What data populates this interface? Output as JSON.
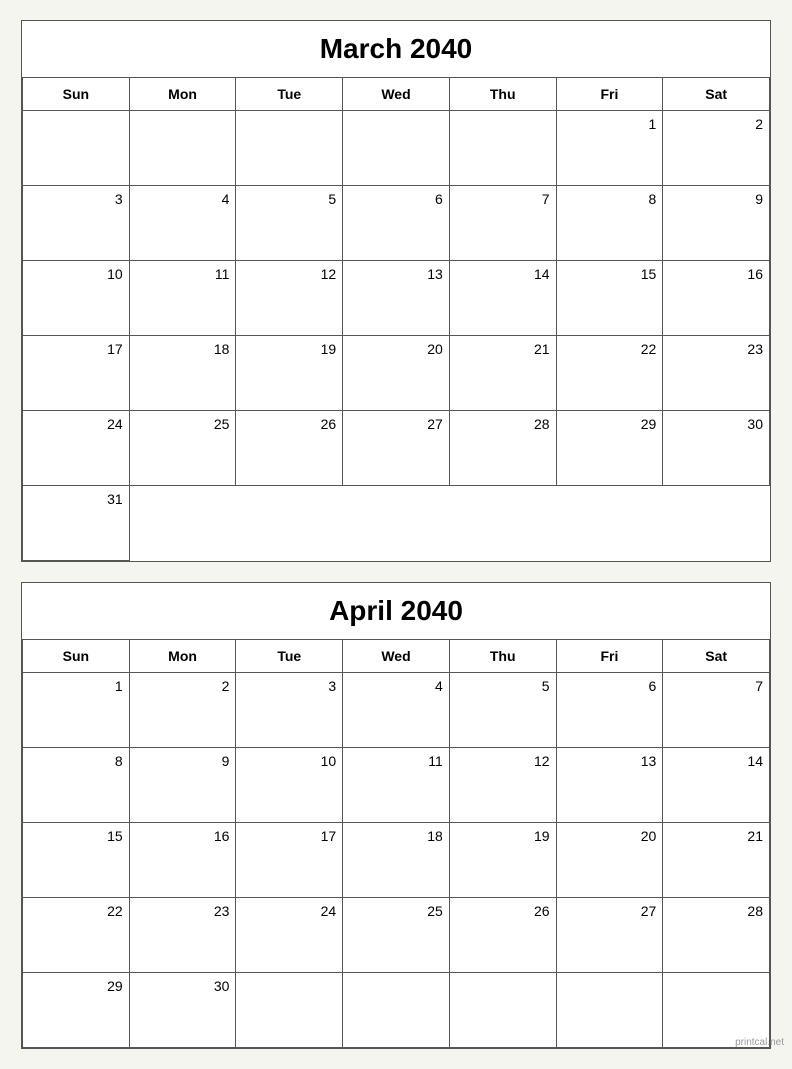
{
  "calendars": [
    {
      "title": "March 2040",
      "headers": [
        "Sun",
        "Mon",
        "Tue",
        "Wed",
        "Thu",
        "Fri",
        "Sat"
      ],
      "weeks": [
        [
          "",
          "",
          "",
          "",
          "",
          "1",
          "2",
          "3"
        ],
        [
          "4",
          "5",
          "6",
          "7",
          "8",
          "9",
          "10"
        ],
        [
          "11",
          "12",
          "13",
          "14",
          "15",
          "16",
          "17"
        ],
        [
          "18",
          "19",
          "20",
          "21",
          "22",
          "23",
          "24"
        ],
        [
          "25",
          "26",
          "27",
          "28",
          "29",
          "30",
          "31"
        ]
      ]
    },
    {
      "title": "April 2040",
      "headers": [
        "Sun",
        "Mon",
        "Tue",
        "Wed",
        "Thu",
        "Fri",
        "Sat"
      ],
      "weeks": [
        [
          "1",
          "2",
          "3",
          "4",
          "5",
          "6",
          "7"
        ],
        [
          "8",
          "9",
          "10",
          "11",
          "12",
          "13",
          "14"
        ],
        [
          "15",
          "16",
          "17",
          "18",
          "19",
          "20",
          "21"
        ],
        [
          "22",
          "23",
          "24",
          "25",
          "26",
          "27",
          "28"
        ],
        [
          "29",
          "30",
          "",
          "",
          "",
          "",
          ""
        ]
      ]
    }
  ],
  "watermark": "printcal.net"
}
